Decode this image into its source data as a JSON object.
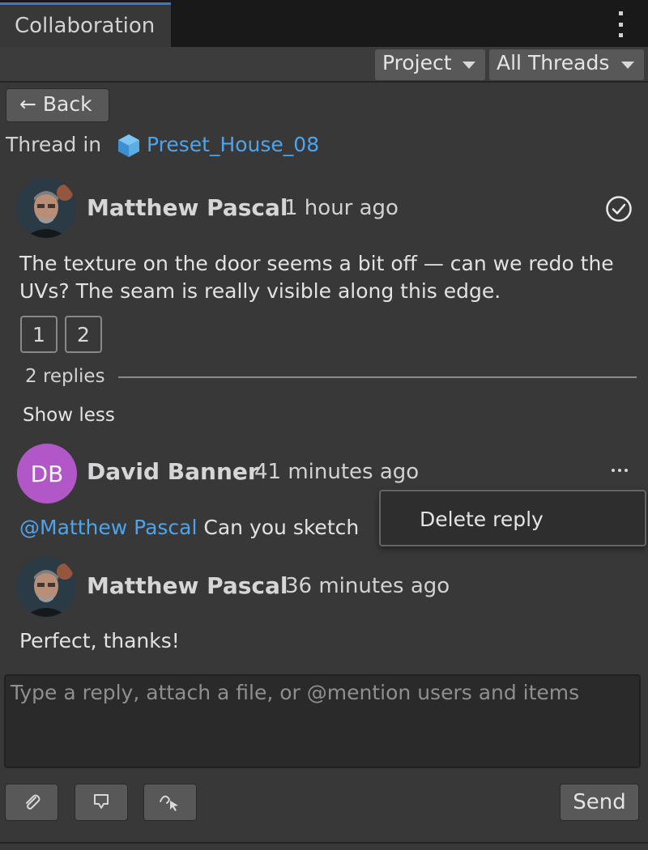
{
  "window": {
    "tab_title": "Collaboration",
    "menu_icon": "kebab-menu-icon"
  },
  "toolbar": {
    "scope_dropdown": "Project",
    "filter_dropdown": "All Threads"
  },
  "navigation": {
    "back_label": "Back",
    "back_icon": "arrow-left-icon"
  },
  "thread": {
    "prefix": "Thread in",
    "asset_icon": "cube-icon",
    "asset_name": "Preset_House_08",
    "asset_link_color": "#4ea4ec"
  },
  "original_comment": {
    "author": "Matthew Pascal",
    "time": "1 hour ago",
    "text": "The texture on the door seems a bit off — can we redo the UVs? The seam is really visible along this edge.",
    "attachments": [
      "1",
      "2"
    ],
    "resolve_icon": "check-circle-icon"
  },
  "replies_section": {
    "count_label": "2 replies",
    "toggle_label": "Show less"
  },
  "replies": [
    {
      "author": "David Banner",
      "initials": "DB",
      "avatar_color": "#b257c7",
      "time": "41 minutes ago",
      "mention": "@Matthew Pascal",
      "text": "Can you sketch",
      "more_icon": "more-horizontal-icon"
    },
    {
      "author": "Matthew Pascal",
      "time": "36 minutes ago",
      "text": "Perfect, thanks!"
    }
  ],
  "context_menu": {
    "items": [
      "Delete reply"
    ]
  },
  "composer": {
    "placeholder": "Type a reply, attach a file, or @mention users and items",
    "tools": [
      "paperclip-icon",
      "marker-pin-icon",
      "draw-pointer-icon"
    ],
    "send_label": "Send"
  }
}
